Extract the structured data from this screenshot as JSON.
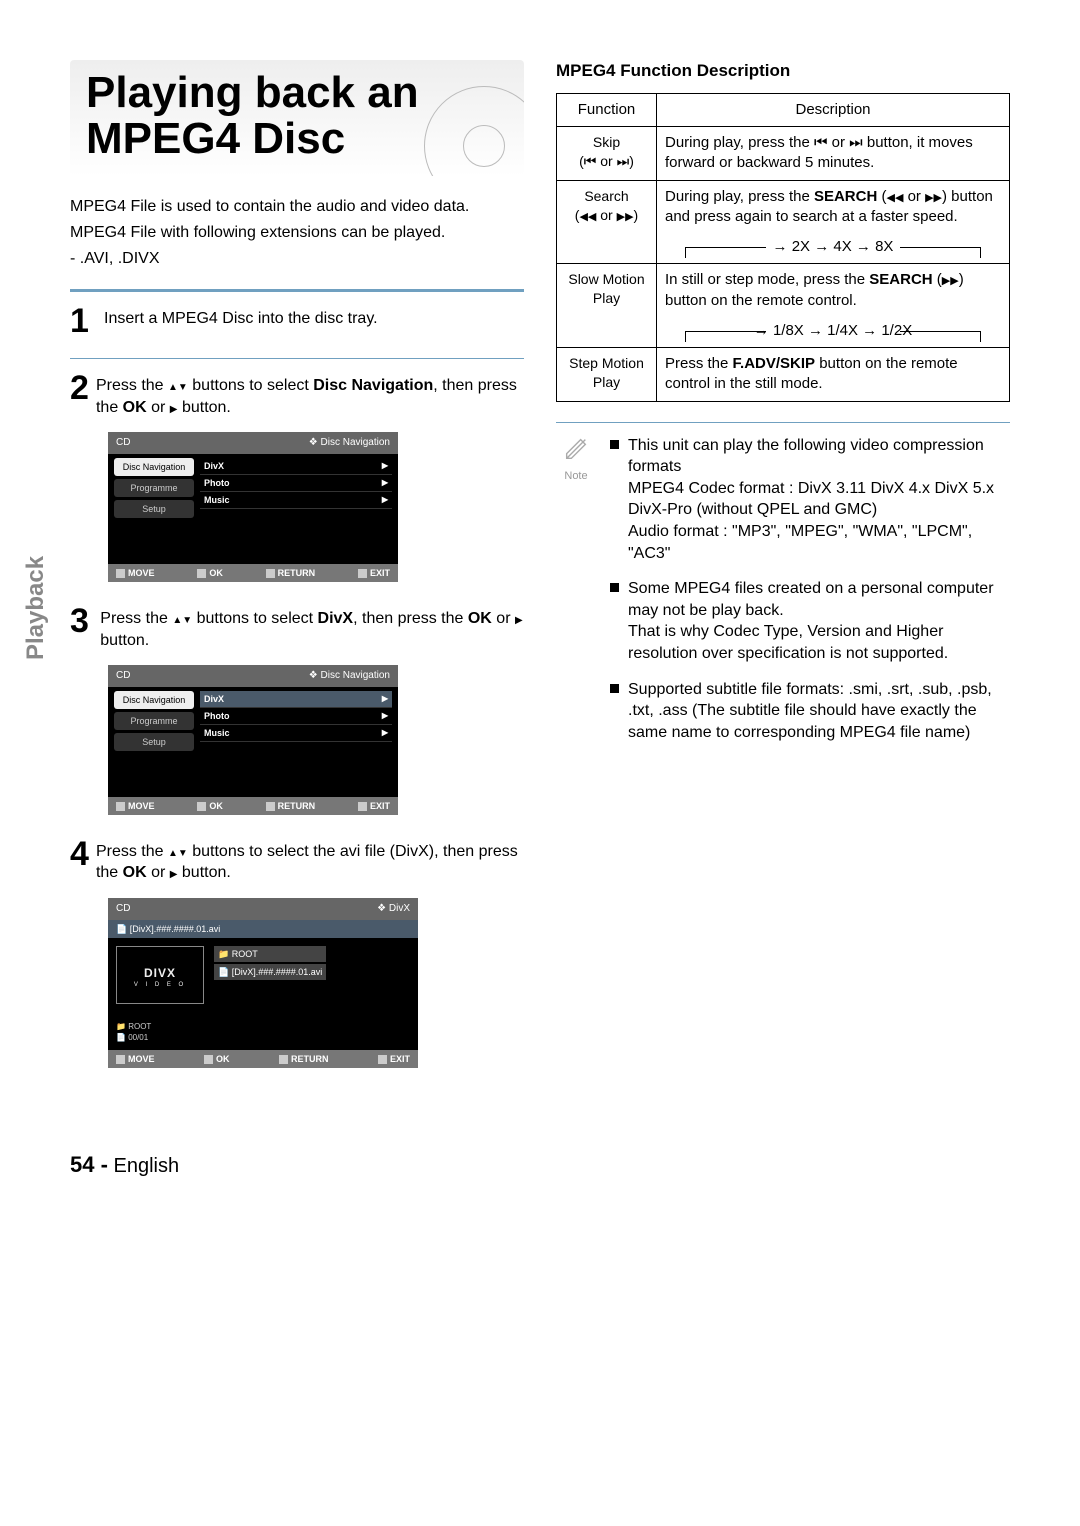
{
  "title_line1": "Playing back an",
  "title_line2": "MPEG4 Disc",
  "intro": {
    "p1": "MPEG4 File is used to contain the audio and video data.",
    "p2": "MPEG4 File with following extensions can be played.",
    "p3": "- .AVI, .DIVX"
  },
  "sidebar_label": "Playback",
  "steps": {
    "s1": {
      "num": "1",
      "text": "Insert a MPEG4 Disc into the disc tray."
    },
    "s2": {
      "num": "2",
      "text_a": "Press the ",
      "text_b": " buttons to select ",
      "bold1": "Disc Navigation",
      "text_c": ", then press the ",
      "bold2": "OK",
      "text_d": " or ",
      "text_e": " button."
    },
    "s3": {
      "num": "3",
      "text_a": "Press the ",
      "text_b": " buttons to select ",
      "bold1": "DivX",
      "text_c": ", then press the ",
      "bold2": "OK",
      "text_d": " or ",
      "text_e": " button."
    },
    "s4": {
      "num": "4",
      "text_a": "Press the ",
      "text_b": " buttons to select the avi file (DivX), then press the ",
      "bold2": "OK",
      "text_d": " or ",
      "text_e": " button."
    }
  },
  "osd": {
    "cd": "CD",
    "disc_nav": "Disc Navigation",
    "divx_hdr": "DivX",
    "tabs": {
      "discnav": "Disc Navigation",
      "programme": "Programme",
      "setup": "Setup"
    },
    "rows": {
      "divx": "DivX",
      "photo": "Photo",
      "music": "Music"
    },
    "foot": {
      "move": "MOVE",
      "ok": "OK",
      "return": "RETURN",
      "exit": "EXIT"
    },
    "divx_file": "[DivX].###.####.01.avi",
    "root": "ROOT",
    "counter": "00/01",
    "logo": "DIVX",
    "logo_sub": "V I D E O"
  },
  "right_title": "MPEG4 Function Description",
  "table": {
    "h1": "Function",
    "h2": "Description",
    "skip": {
      "fn": "Skip",
      "sub_a": "(",
      "sub_mid": " or ",
      "sub_b": ")",
      "desc_a": "During play, press the ",
      "desc_mid": " or ",
      "desc_b": " button, it moves forward or backward 5 minutes."
    },
    "search": {
      "fn": "Search",
      "sub_a": "(",
      "sub_mid": " or ",
      "sub_b": ")",
      "desc_a": "During play, press the ",
      "bold": "SEARCH",
      "desc_b": " (",
      "desc_mid": " or ",
      "desc_c": ") button and press again to search at a faster speed.",
      "chain": "2X → 4X → 8X"
    },
    "slow": {
      "fn": "Slow Motion Play",
      "desc_a": "In still or step mode, press the ",
      "bold": "SEARCH",
      "desc_b": " (",
      "desc_c": ") button on the remote control.",
      "chain": "1/8X → 1/4X → 1/2X"
    },
    "step": {
      "fn": "Step Motion Play",
      "desc_a": "Press the ",
      "bold": "F.ADV/SKIP",
      "desc_b": " button on the remote control in the still mode."
    }
  },
  "note_label": "Note",
  "notes": {
    "n1_a": "This unit can play the following video compression formats",
    "n1_b": "MPEG4 Codec format : DivX 3.11 DivX 4.x DivX 5.x DivX-Pro (without QPEL and GMC)",
    "n1_c": "Audio format : \"MP3\", \"MPEG\", \"WMA\", \"LPCM\", \"AC3\"",
    "n2_a": "Some MPEG4 files created on a personal computer may not be play back.",
    "n2_b": "That is why Codec Type, Version and Higher resolution over specification is not supported.",
    "n3": "Supported subtitle file formats: .smi, .srt, .sub, .psb, .txt, .ass (The subtitle file should have exactly the same name to corresponding MPEG4 file name)"
  },
  "footer": {
    "page": "54 -",
    "lang": "English"
  }
}
